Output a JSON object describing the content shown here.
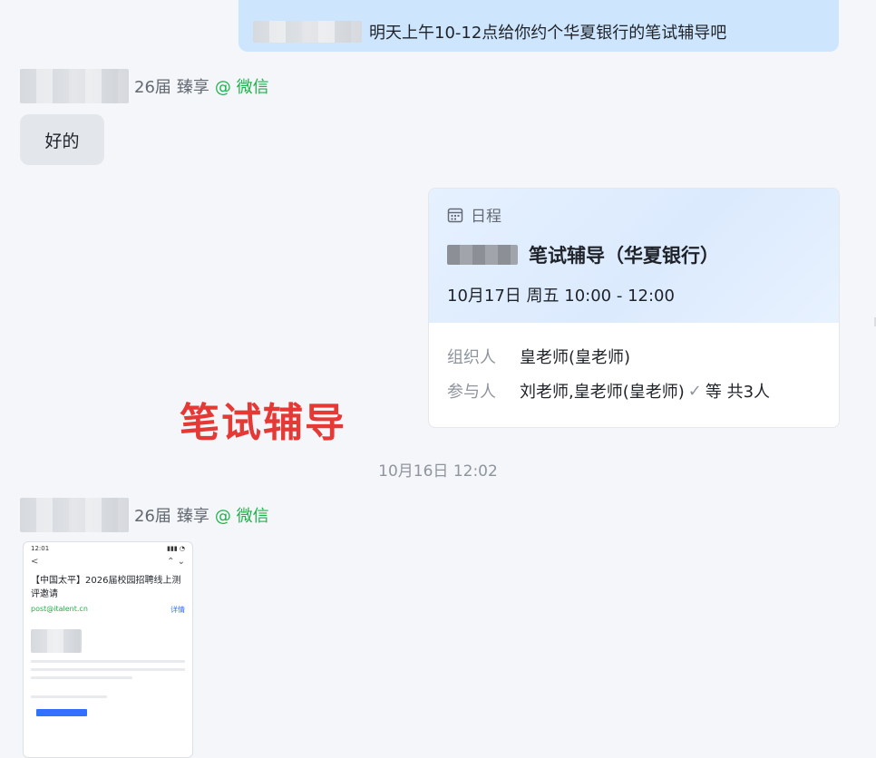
{
  "messages": {
    "outgoing_top": {
      "text": "明天上午10-12点给你约个华夏银行的笔试辅导吧"
    },
    "sender1": {
      "grade": "26届",
      "name": "臻享",
      "channel": "@ 微信"
    },
    "reply": {
      "text": "好的"
    },
    "sender2": {
      "grade": "26届",
      "name": "臻享",
      "channel": "@ 微信"
    }
  },
  "calendar_card": {
    "label": "日程",
    "title": "笔试辅导（华夏银行）",
    "time": "10月17日 周五 10:00 - 12:00",
    "organizer_label": "组织人",
    "organizer": "皇老师(皇老师)",
    "attendees_label": "参与人",
    "attendees": "刘老师,皇老师(皇老师)",
    "attendees_more": "等 共3人"
  },
  "overlay_label": "笔试辅导",
  "timestamp": "10月16日 12:02",
  "thumbnail": {
    "time": "12:01",
    "back": "<",
    "subject": "【中国太平】2026届校园招聘线上测评邀请",
    "from": "post@italent.cn",
    "detail": "详情"
  },
  "icons": {
    "calendar": "calendar-icon",
    "check": "check-icon"
  },
  "colors": {
    "wechat_green": "#1fb24a",
    "annotation_red": "#e53935",
    "bubble_out": "#cde6fd"
  }
}
